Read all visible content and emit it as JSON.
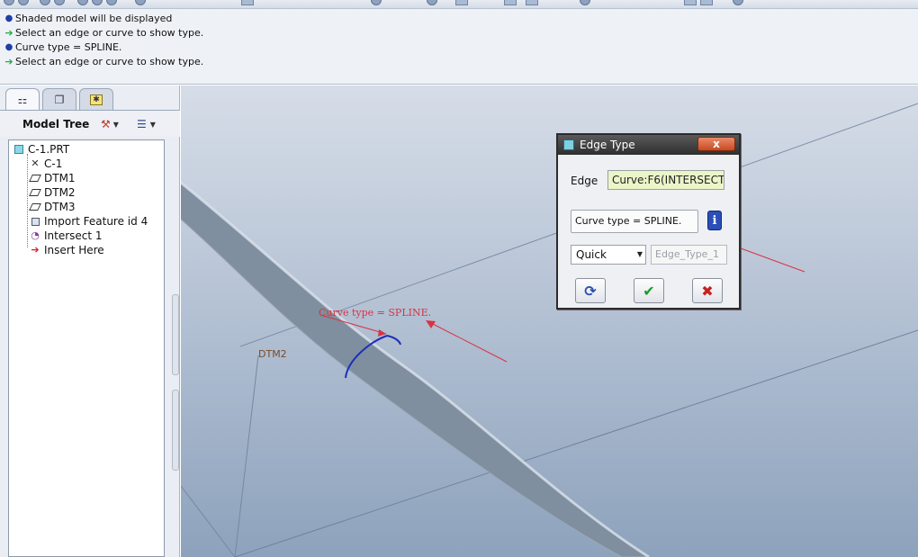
{
  "messages": [
    {
      "icon": "info-bullet-icon",
      "text": "Shaded model will be displayed"
    },
    {
      "icon": "prompt-arrow-icon",
      "text": "Select an edge or curve to show type."
    },
    {
      "icon": "info-bullet-icon",
      "text": "Curve type = SPLINE."
    },
    {
      "icon": "prompt-arrow-icon",
      "text": "Select an edge or curve to show type."
    }
  ],
  "left_panel": {
    "tabs": [
      "model-tree-tab-icon",
      "layers-tab-icon",
      "favorites-tab-icon"
    ],
    "title": "Model Tree",
    "tree": [
      {
        "label": "C-1.PRT",
        "icon": "part-icon"
      },
      {
        "label": "C-1",
        "icon": "csys-icon"
      },
      {
        "label": "DTM1",
        "icon": "datum-plane-icon"
      },
      {
        "label": "DTM2",
        "icon": "datum-plane-icon"
      },
      {
        "label": "DTM3",
        "icon": "datum-plane-icon"
      },
      {
        "label": "Import Feature id 4",
        "icon": "import-feature-icon"
      },
      {
        "label": "Intersect 1",
        "icon": "intersect-curve-icon"
      },
      {
        "label": "Insert Here",
        "icon": "insert-arrow-icon"
      }
    ]
  },
  "viewport": {
    "annotation": "Curve type  =  SPLINE.",
    "datum_label": "DTM2"
  },
  "dialog": {
    "title": "Edge Type",
    "close_label": "x",
    "edge_label": "Edge",
    "edge_value": "Curve:F6(INTERSECT",
    "info_text": "Curve type = SPLINE.",
    "info_icon_label": "i",
    "mode_selected": "Quick",
    "name_value": "Edge_Type_1",
    "buttons": [
      "repeat-icon",
      "ok-check-icon",
      "cancel-x-icon"
    ]
  },
  "colors": {
    "annotation_red": "#d9333f",
    "edge_highlight_blue": "#1d2fb8",
    "edge_field_bg": "#eaf6c8"
  }
}
